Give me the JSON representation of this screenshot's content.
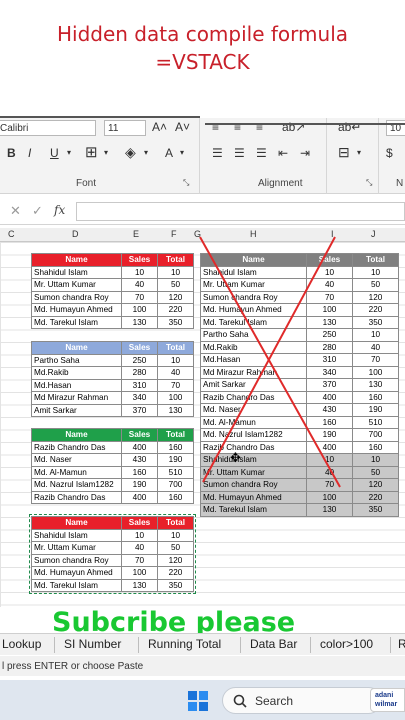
{
  "title": {
    "line1": "Hidden data compile formula",
    "line2": "=VSTACK"
  },
  "ribbon": {
    "font_name": "Calibri",
    "font_size": "11",
    "size_alt": "10",
    "btn_bold": "B",
    "btn_italic": "I",
    "btn_underline": "U",
    "btn_fontcolor": "A",
    "group_font": "Font",
    "group_alignment": "Alignment",
    "group_cut": "N"
  },
  "formula_bar": {
    "fx": "fx",
    "value": ""
  },
  "column_headers": [
    "C",
    "D",
    "E",
    "F",
    "G",
    "H",
    "I",
    "J"
  ],
  "colors": {
    "red": "#e8202a",
    "blue": "#8ea9db",
    "green": "#1fa04a",
    "gray": "#808080",
    "title": "#c8202a",
    "subscribe": "#19c832"
  },
  "table1": {
    "headers": [
      "Name",
      "Sales",
      "Total"
    ],
    "rows": [
      [
        "Shahidul Islam",
        "10",
        "10"
      ],
      [
        "Mr. Uttam Kumar",
        "40",
        "50"
      ],
      [
        "Sumon chandra Roy",
        "70",
        "120"
      ],
      [
        "Md. Humayun Ahmed",
        "100",
        "220"
      ],
      [
        "Md. Tarekul Islam",
        "130",
        "350"
      ]
    ]
  },
  "table2": {
    "headers": [
      "Name",
      "Sales",
      "Total"
    ],
    "rows": [
      [
        "Partho Saha",
        "250",
        "10"
      ],
      [
        "Md.Rakib",
        "280",
        "40"
      ],
      [
        "Md.Hasan",
        "310",
        "70"
      ],
      [
        "Md Mirazur Rahman",
        "340",
        "100"
      ],
      [
        "Amit Sarkar",
        "370",
        "130"
      ]
    ]
  },
  "table3": {
    "headers": [
      "Name",
      "Sales",
      "Total"
    ],
    "rows": [
      [
        "Razib Chandro Das",
        "400",
        "160"
      ],
      [
        "Md. Naser",
        "430",
        "190"
      ],
      [
        "Md. Al-Mamun",
        "160",
        "510"
      ],
      [
        "Md. Nazrul Islam1282",
        "190",
        "700"
      ],
      [
        "Razib Chandro Das",
        "400",
        "160"
      ]
    ]
  },
  "table4": {
    "headers": [
      "Name",
      "Sales",
      "Total"
    ],
    "rows": [
      [
        "Shahidul Islam",
        "10",
        "10"
      ],
      [
        "Mr. Uttam Kumar",
        "40",
        "50"
      ],
      [
        "Sumon chandra Roy",
        "70",
        "120"
      ],
      [
        "Md. Humayun Ahmed",
        "100",
        "220"
      ],
      [
        "Md. Tarekul Islam",
        "130",
        "350"
      ]
    ]
  },
  "result": {
    "headers": [
      "Name",
      "Sales",
      "Total"
    ],
    "rows": [
      [
        "Shahidul Islam",
        "10",
        "10"
      ],
      [
        "Mr. Uttam Kumar",
        "40",
        "50"
      ],
      [
        "Sumon chandra Roy",
        "70",
        "120"
      ],
      [
        "Md. Humayun Ahmed",
        "100",
        "220"
      ],
      [
        "Md. Tarekul Islam",
        "130",
        "350"
      ],
      [
        "Partho Saha",
        "250",
        "10"
      ],
      [
        "Md.Rakib",
        "280",
        "40"
      ],
      [
        "Md.Hasan",
        "310",
        "70"
      ],
      [
        "Md Mirazur Rahman",
        "340",
        "100"
      ],
      [
        "Amit Sarkar",
        "370",
        "130"
      ],
      [
        "Razib Chandro Das",
        "400",
        "160"
      ],
      [
        "Md. Naser",
        "430",
        "190"
      ],
      [
        "Md. Al-Mamun",
        "160",
        "510"
      ],
      [
        "Md. Nazrul Islam1282",
        "190",
        "700"
      ],
      [
        "Razib Chandro Das",
        "400",
        "160"
      ],
      [
        "Shahidul Islam",
        "10",
        "10"
      ],
      [
        "Mr. Uttam Kumar",
        "40",
        "50"
      ],
      [
        "Sumon chandra Roy",
        "70",
        "120"
      ],
      [
        "Md. Humayun Ahmed",
        "100",
        "220"
      ],
      [
        "Md. Tarekul Islam",
        "130",
        "350"
      ]
    ]
  },
  "overlay_text": "Subcribe please",
  "sheet_tabs": [
    "Lookup",
    "SI Number",
    "Running Total",
    "Data Bar",
    "color>100",
    "R"
  ],
  "status_text": "l press ENTER or choose Paste",
  "taskbar": {
    "search_label": "Search",
    "brand_line1": "adani",
    "brand_line2": "wilmar"
  }
}
